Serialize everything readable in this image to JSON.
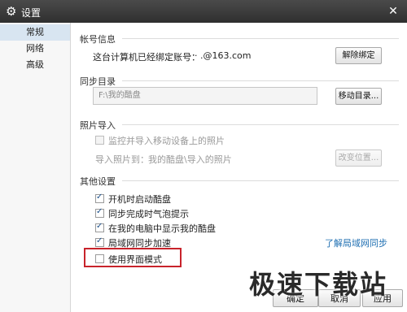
{
  "window": {
    "title": "设置",
    "icon": "gear-icon"
  },
  "sidebar": {
    "items": [
      {
        "label": "常规",
        "active": true
      },
      {
        "label": "网络",
        "active": false
      },
      {
        "label": "高级",
        "active": false
      }
    ]
  },
  "account": {
    "section_title": "帐号信息",
    "bound_text": "这台计算机已经绑定账号：",
    "email": "·  ·  .@163.com",
    "unbind_label": "解除绑定"
  },
  "sync_dir": {
    "section_title": "同步目录",
    "path": "F:\\我的酷盘",
    "move_label": "移动目录..."
  },
  "photo_import": {
    "section_title": "照片导入",
    "monitor_label": "监控并导入移动设备上的照片",
    "import_to_label": "导入照片到：",
    "import_to_path": "我的酷盘\\导入的照片",
    "change_label": "改变位置..."
  },
  "other": {
    "section_title": "其他设置",
    "options": [
      {
        "label": "开机时启动酷盘",
        "checked": true
      },
      {
        "label": "同步完成时气泡提示",
        "checked": true
      },
      {
        "label": "在我的电脑中显示我的酷盘",
        "checked": true
      },
      {
        "label": "局域网同步加速",
        "checked": true
      },
      {
        "label": "使用界面模式",
        "checked": false
      }
    ],
    "lan_link": "了解局域网同步"
  },
  "footer": {
    "ok_label": "确定",
    "cancel_label": "取消",
    "apply_label": "应用"
  },
  "watermark": "极速下载站",
  "colors": {
    "titlebar": "#333333",
    "highlight": "#c8232b",
    "link": "#1f6fb2",
    "sidebar_active": "#d8e5f1"
  }
}
